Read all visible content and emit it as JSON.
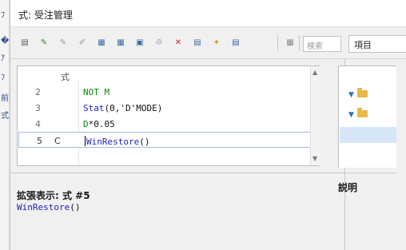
{
  "background_app": {
    "left_glyphs": [
      "ﾌ",
      "�",
      "ｱ",
      "ﾌ",
      "前",
      "式"
    ]
  },
  "window": {
    "title": "式: 受注管理"
  },
  "toolbar": {
    "icons": [
      {
        "name": "properties-icon",
        "glyph": "▤",
        "color": "#5a5a5a"
      },
      {
        "name": "add-expression-icon",
        "glyph": "✎",
        "color": "#3a7a3a"
      },
      {
        "name": "insert-icon",
        "glyph": "✎",
        "color": "#9a9a9a"
      },
      {
        "name": "edit-icon",
        "glyph": "✐",
        "color": "#9a9a9a"
      },
      {
        "name": "copy-icon",
        "glyph": "▦",
        "color": "#3a6aa0"
      },
      {
        "name": "grid-icon",
        "glyph": "▦",
        "color": "#3a6aa0"
      },
      {
        "name": "table-icon",
        "glyph": "▣",
        "color": "#3a6aa0"
      },
      {
        "name": "macro-icon",
        "glyph": "♲",
        "color": "#3a6aa0"
      },
      {
        "name": "delete-icon",
        "glyph": "✕",
        "color": "#d11e1e"
      },
      {
        "name": "save-icon",
        "glyph": "▤",
        "color": "#3a6aa0"
      },
      {
        "name": "tools-icon",
        "glyph": "✦",
        "color": "#c8a020"
      },
      {
        "name": "list-icon",
        "glyph": "▤",
        "color": "#3a6aa0"
      },
      {
        "name": "calculator-icon",
        "glyph": "▦",
        "color": "#8a8a8a"
      }
    ],
    "search_placeholder": "検索",
    "property_tab": "項目"
  },
  "editor": {
    "column_header": "式",
    "rows": [
      {
        "num": "2",
        "flag": "",
        "segments": [
          {
            "text": "NOT M",
            "cls": "kw-green"
          }
        ]
      },
      {
        "num": "3",
        "flag": "",
        "segments": [
          {
            "text": "Stat",
            "cls": "kw-blue"
          },
          {
            "text": "(0,'D'MODE)",
            "cls": "plain"
          }
        ]
      },
      {
        "num": "4",
        "flag": "",
        "segments": [
          {
            "text": "D",
            "cls": "kw-green"
          },
          {
            "text": "*0.05",
            "cls": "plain"
          }
        ]
      },
      {
        "num": "5",
        "flag": "C",
        "segments": [
          {
            "text": "WinRestore",
            "cls": "kw-blue"
          },
          {
            "text": "()",
            "cls": "plain"
          }
        ],
        "active": true
      }
    ]
  },
  "tree": {
    "items": [
      {
        "arrow": "▼"
      },
      {
        "arrow": "▼"
      }
    ]
  },
  "expanded_view": {
    "label": "拡張表示: 式 #5",
    "func": "WinRestore",
    "args": "()"
  },
  "description_pane": {
    "label": "説明"
  }
}
